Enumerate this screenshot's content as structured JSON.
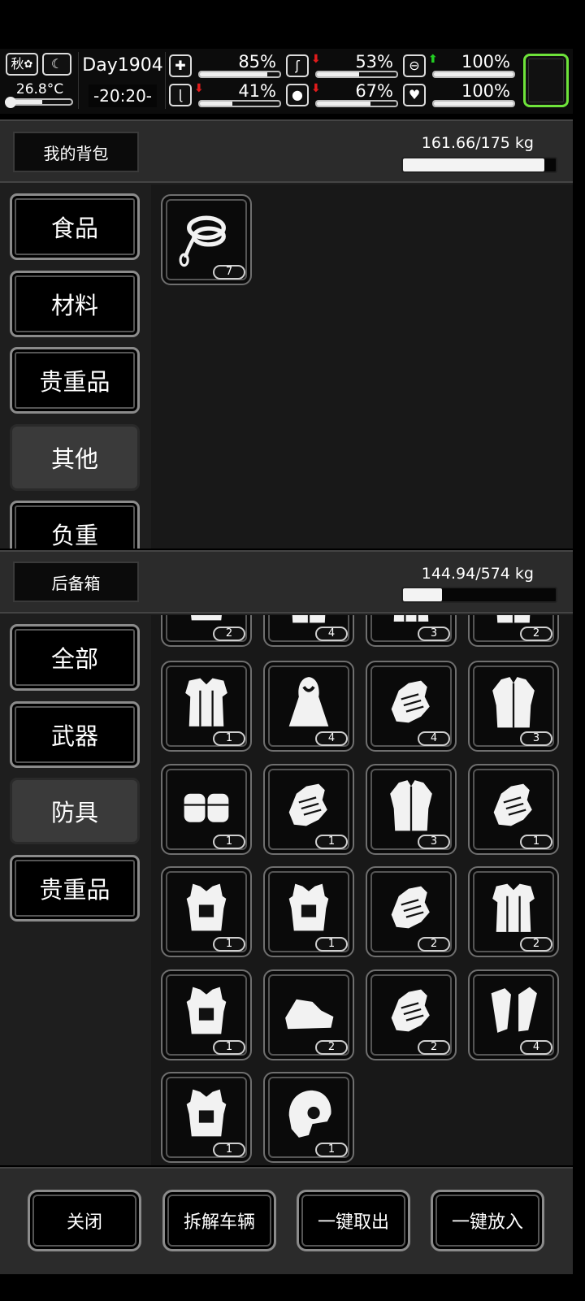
{
  "hud": {
    "season": "秋",
    "temperature": "26.8°C",
    "day": "Day1904",
    "time": "-20:20-",
    "stats": [
      {
        "name": "health",
        "percent": "85%",
        "fraction": 0.85,
        "icon": "medkit-icon",
        "arrow": ""
      },
      {
        "name": "hunger",
        "percent": "53%",
        "fraction": 0.53,
        "icon": "stomach-icon",
        "arrow": "down"
      },
      {
        "name": "sleep",
        "percent": "100%",
        "fraction": 1.0,
        "icon": "pill-icon",
        "arrow": "up"
      },
      {
        "name": "stamina",
        "percent": "41%",
        "fraction": 0.41,
        "icon": "boot-icon",
        "arrow": "down"
      },
      {
        "name": "thirst",
        "percent": "67%",
        "fraction": 0.67,
        "icon": "water-drop-icon",
        "arrow": "down"
      },
      {
        "name": "mood",
        "percent": "100%",
        "fraction": 1.0,
        "icon": "heart-icon",
        "arrow": ""
      }
    ],
    "colors": {
      "arrow_down": "#e01b1b",
      "arrow_up": "#22cc22",
      "menu_border": "#6ee33a"
    }
  },
  "backpack": {
    "title": "我的背包",
    "weight": "161.66/175 kg",
    "load_fraction": 0.924,
    "categories": [
      {
        "label": "食品",
        "active": false
      },
      {
        "label": "材料",
        "active": false
      },
      {
        "label": "贵重品",
        "active": false
      },
      {
        "label": "其他",
        "active": true
      },
      {
        "label": "负重",
        "active": false
      }
    ],
    "items": [
      {
        "icon": "rope-icon",
        "qty": "7"
      }
    ]
  },
  "trunk": {
    "title": "后备箱",
    "weight": "144.94/574 kg",
    "load_fraction": 0.253,
    "categories": [
      {
        "label": "全部",
        "active": false
      },
      {
        "label": "武器",
        "active": false
      },
      {
        "label": "防具",
        "active": true
      },
      {
        "label": "贵重品",
        "active": false
      }
    ],
    "partial_items": [
      {
        "icon": "armor-piece-icon",
        "qty": "2"
      },
      {
        "icon": "jacket-icon",
        "qty": "4"
      },
      {
        "icon": "cloth-icon",
        "qty": "3"
      },
      {
        "icon": "coat-icon",
        "qty": "2"
      }
    ],
    "items": [
      {
        "icon": "fur-vest-icon",
        "qty": "1"
      },
      {
        "icon": "hooded-cloak-icon",
        "qty": "4"
      },
      {
        "icon": "gauntlet-icon",
        "qty": "4"
      },
      {
        "icon": "fur-coat-icon",
        "qty": "3"
      },
      {
        "icon": "knee-pads-icon",
        "qty": "1"
      },
      {
        "icon": "fingerless-gloves-icon",
        "qty": "1"
      },
      {
        "icon": "long-coat-icon",
        "qty": "3"
      },
      {
        "icon": "tactical-gloves-icon",
        "qty": "1"
      },
      {
        "icon": "plate-carrier-icon",
        "qty": "1"
      },
      {
        "icon": "body-armor-icon",
        "qty": "1"
      },
      {
        "icon": "leather-gloves-icon",
        "qty": "2"
      },
      {
        "icon": "tactical-vest-icon",
        "qty": "2"
      },
      {
        "icon": "harness-armor-icon",
        "qty": "1"
      },
      {
        "icon": "spiked-boots-icon",
        "qty": "2"
      },
      {
        "icon": "knuckle-gloves-icon",
        "qty": "2"
      },
      {
        "icon": "shin-guards-icon",
        "qty": "4"
      },
      {
        "icon": "chest-armor-icon",
        "qty": "1"
      },
      {
        "icon": "helmet-icon",
        "qty": "1"
      }
    ]
  },
  "footer": {
    "close": "关闭",
    "dismantle": "拆解车辆",
    "take_all": "一键取出",
    "store_all": "一键放入"
  }
}
